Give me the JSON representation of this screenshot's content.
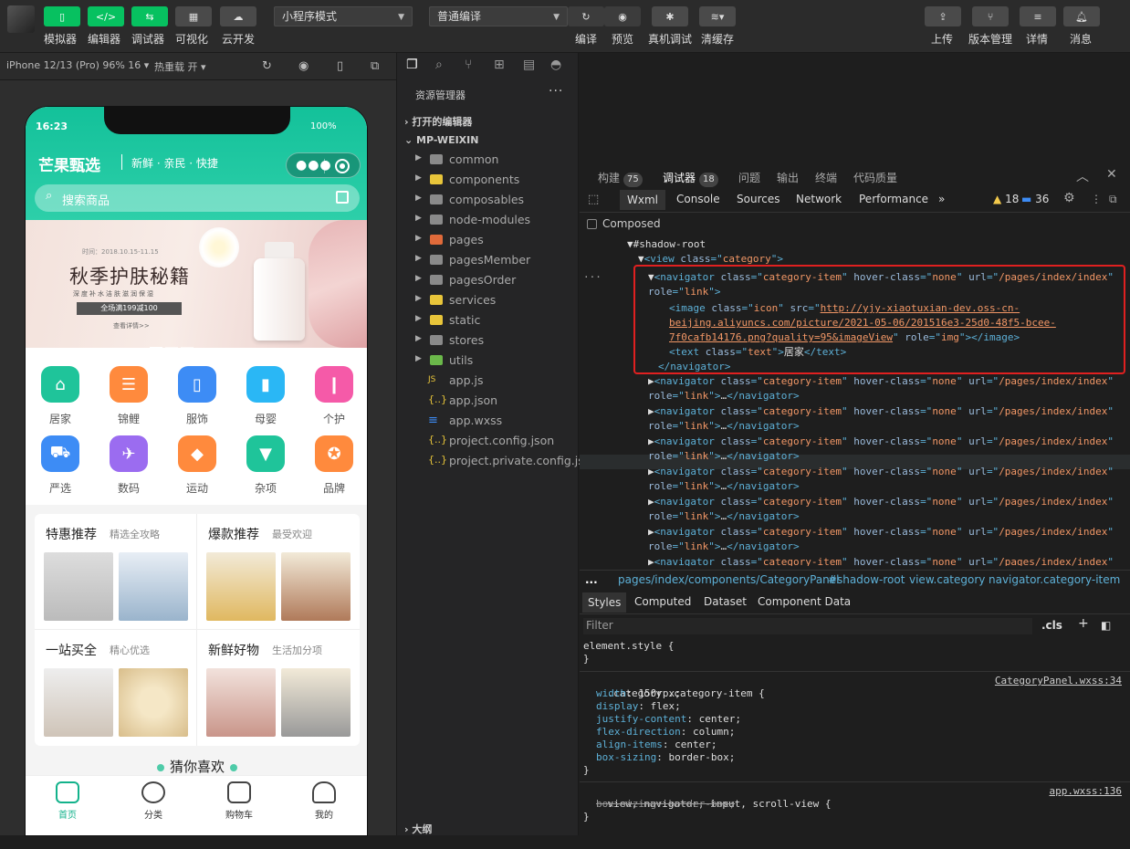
{
  "toolbar": {
    "left_buttons": [
      {
        "label": "模拟器",
        "icon": "phone-icon"
      },
      {
        "label": "编辑器",
        "icon": "code-icon"
      },
      {
        "label": "调试器",
        "icon": "debug-icon"
      },
      {
        "label": "可视化",
        "icon": "layout-icon"
      },
      {
        "label": "云开发",
        "icon": "cloud-icon"
      }
    ],
    "mode_select": "小程序模式",
    "compile_select": "普通编译",
    "mid_buttons": [
      {
        "label": "编译",
        "icon": "refresh-icon"
      },
      {
        "label": "预览",
        "icon": "eye-icon"
      },
      {
        "label": "真机调试",
        "icon": "bug-icon"
      },
      {
        "label": "清缓存",
        "icon": "layers-icon"
      }
    ],
    "right_buttons": [
      {
        "label": "上传",
        "icon": "upload-icon"
      },
      {
        "label": "版本管理",
        "icon": "branch-icon"
      },
      {
        "label": "详情",
        "icon": "menu-icon"
      },
      {
        "label": "消息",
        "icon": "bell-icon"
      }
    ]
  },
  "simbar": {
    "device": "iPhone 12/13 (Pro) 96% 16 ▾",
    "hotreload": "热重载 开 ▾"
  },
  "phone": {
    "time": "16:23",
    "battery": "100%",
    "brand": "芒果甄选",
    "brand_sub": "新鲜 · 亲民 · 快捷",
    "search_placeholder": "搜索商品",
    "banner": {
      "date": "时间：2018.10.15-11.15",
      "title": "秋季护肤秘籍",
      "sub": "深度补水洁肤滋润保湿",
      "tag": "全场满199减100",
      "more": "查看详情>>"
    },
    "categories": [
      {
        "label": "居家",
        "color": "#1fc49a"
      },
      {
        "label": "锦鲤",
        "color": "#ff8a3d"
      },
      {
        "label": "服饰",
        "color": "#3d8cf5"
      },
      {
        "label": "母婴",
        "color": "#2ab7f5"
      },
      {
        "label": "个护",
        "color": "#f55aa8"
      },
      {
        "label": "严选",
        "color": "#3d8cf5"
      },
      {
        "label": "数码",
        "color": "#9b6cf0"
      },
      {
        "label": "运动",
        "color": "#ff8a3d"
      },
      {
        "label": "杂项",
        "color": "#1fc49a"
      },
      {
        "label": "品牌",
        "color": "#ff8a3d"
      }
    ],
    "promos": [
      {
        "title": "特惠推荐",
        "sub": "精选全攻略"
      },
      {
        "title": "爆款推荐",
        "sub": "最受欢迎"
      },
      {
        "title": "一站买全",
        "sub": "精心优选"
      },
      {
        "title": "新鲜好物",
        "sub": "生活加分项"
      }
    ],
    "guess": "猜你喜欢",
    "tabs": [
      "首页",
      "分类",
      "购物车",
      "我的"
    ]
  },
  "explorer": {
    "title": "资源管理器",
    "open_editors": "打开的编辑器",
    "project": "MP-WEIXIN",
    "folders": [
      {
        "name": "common",
        "color": "#8a8a8a"
      },
      {
        "name": "components",
        "color": "#e8c53a"
      },
      {
        "name": "composables",
        "color": "#8a8a8a"
      },
      {
        "name": "node-modules",
        "color": "#8a8a8a"
      },
      {
        "name": "pages",
        "color": "#e06a3a"
      },
      {
        "name": "pagesMember",
        "color": "#8a8a8a"
      },
      {
        "name": "pagesOrder",
        "color": "#8a8a8a"
      },
      {
        "name": "services",
        "color": "#e8c53a"
      },
      {
        "name": "static",
        "color": "#e8c53a"
      },
      {
        "name": "stores",
        "color": "#8a8a8a"
      },
      {
        "name": "utils",
        "color": "#6bb84a"
      }
    ],
    "files": [
      {
        "name": "app.js",
        "ext": "JS",
        "color": "#e8c53a"
      },
      {
        "name": "app.json",
        "ext": "{..}",
        "color": "#e8c53a"
      },
      {
        "name": "app.wxss",
        "ext": "≡",
        "color": "#3d8cf5"
      },
      {
        "name": "project.config.json",
        "ext": "{..}",
        "color": "#e8c53a"
      },
      {
        "name": "project.private.config.js...",
        "ext": "{..}",
        "color": "#e8c53a"
      }
    ],
    "outline": "大纲"
  },
  "debug": {
    "top_tabs": [
      {
        "label": "构建",
        "badge": "75"
      },
      {
        "label": "调试器",
        "badge": "18"
      },
      {
        "label": "问题",
        "badge": ""
      },
      {
        "label": "输出",
        "badge": ""
      },
      {
        "label": "终端",
        "badge": ""
      },
      {
        "label": "代码质量",
        "badge": ""
      }
    ],
    "dev_tabs": [
      "Wxml",
      "Console",
      "Sources",
      "Network",
      "Performance",
      "»"
    ],
    "warn_count": "18",
    "info_count": "36",
    "composed": "Composed",
    "dom": {
      "shadow_root": "#shadow-root",
      "view_class": "category",
      "nav_class": "category-item",
      "hover_class": "none",
      "nav_url": "/pages/index/index",
      "role_link": "link",
      "image_class": "icon",
      "image_src_1": "http://yjy-xiaotuxian-dev.oss-cn-",
      "image_src_2": "beijing.aliyuncs.com/picture/2021-05-06/201516e3-25d0-48f5-bcee-",
      "image_src_3": "7f0cafb14176.png?quality=95&imageView",
      "role_img": "img",
      "text_class": "text",
      "text_value": "居家"
    },
    "crumbs": [
      "...",
      "pages/index/components/CategoryPanel",
      "#shadow-root",
      "view.category",
      "navigator.category-item"
    ],
    "style_tabs": [
      "Styles",
      "Computed",
      "Dataset",
      "Component Data"
    ],
    "filter_placeholder": "Filter",
    "cls": ".cls",
    "rule1_sel": "element.style {",
    "rule2_sel": ".category .category-item {",
    "rule2_src": "CategoryPanel.wxss:34",
    "rule2_props": [
      {
        "p": "width",
        "v": "150rpx;"
      },
      {
        "p": "display",
        "v": "flex;"
      },
      {
        "p": "justify-content",
        "v": "center;"
      },
      {
        "p": "flex-direction",
        "v": "column;"
      },
      {
        "p": "align-items",
        "v": "center;"
      },
      {
        "p": "box-sizing",
        "v": "border-box;"
      }
    ],
    "rule3_sel": "view, navigator, input, scroll-view {",
    "rule3_src": "app.wxss:136",
    "rule3_prop": "box-sizing: border-box;"
  }
}
